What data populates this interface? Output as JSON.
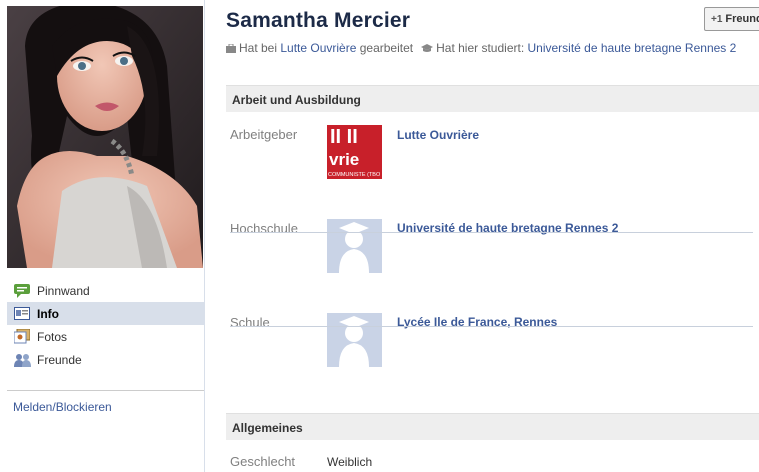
{
  "profile": {
    "name": "Samantha Mercier",
    "add_friend_label": "Freund",
    "summary": {
      "work_prefix": "Hat bei ",
      "work_place": "Lutte Ouvrière",
      "work_suffix": " gearbeitet",
      "study_prefix": "Hat hier studiert: ",
      "study_place": "Université de haute bretagne Rennes 2"
    }
  },
  "sidebar": {
    "items": [
      {
        "label": "Pinnwand",
        "icon": "wall-icon",
        "active": false
      },
      {
        "label": "Info",
        "icon": "info-icon",
        "active": true
      },
      {
        "label": "Fotos",
        "icon": "photos-icon",
        "active": false
      },
      {
        "label": "Freunde",
        "icon": "friends-icon",
        "active": false
      }
    ],
    "report_label": "Melden/Blockieren"
  },
  "sections": {
    "work_education": {
      "title": "Arbeit und Ausbildung",
      "rows": [
        {
          "label": "Arbeitgeber",
          "value": "Lutte Ouvrière",
          "logo_text": "vrie",
          "logo_subtext": "COMMUNISTE (TBO"
        },
        {
          "label": "Hochschule",
          "value": "Université de haute bretagne Rennes 2"
        },
        {
          "label": "Schule",
          "value": "Lycée Ile de France, Rennes"
        }
      ]
    },
    "general": {
      "title": "Allgemeines",
      "rows": [
        {
          "label": "Geschlecht",
          "value": "Weiblich"
        }
      ]
    }
  },
  "colors": {
    "link": "#3b5998",
    "name": "#1c2a47",
    "active_nav": "#d8dfea",
    "section_bg": "#eeeeee",
    "logo_red": "#c8202a",
    "placeholder_blue": "#c9d3e6"
  }
}
